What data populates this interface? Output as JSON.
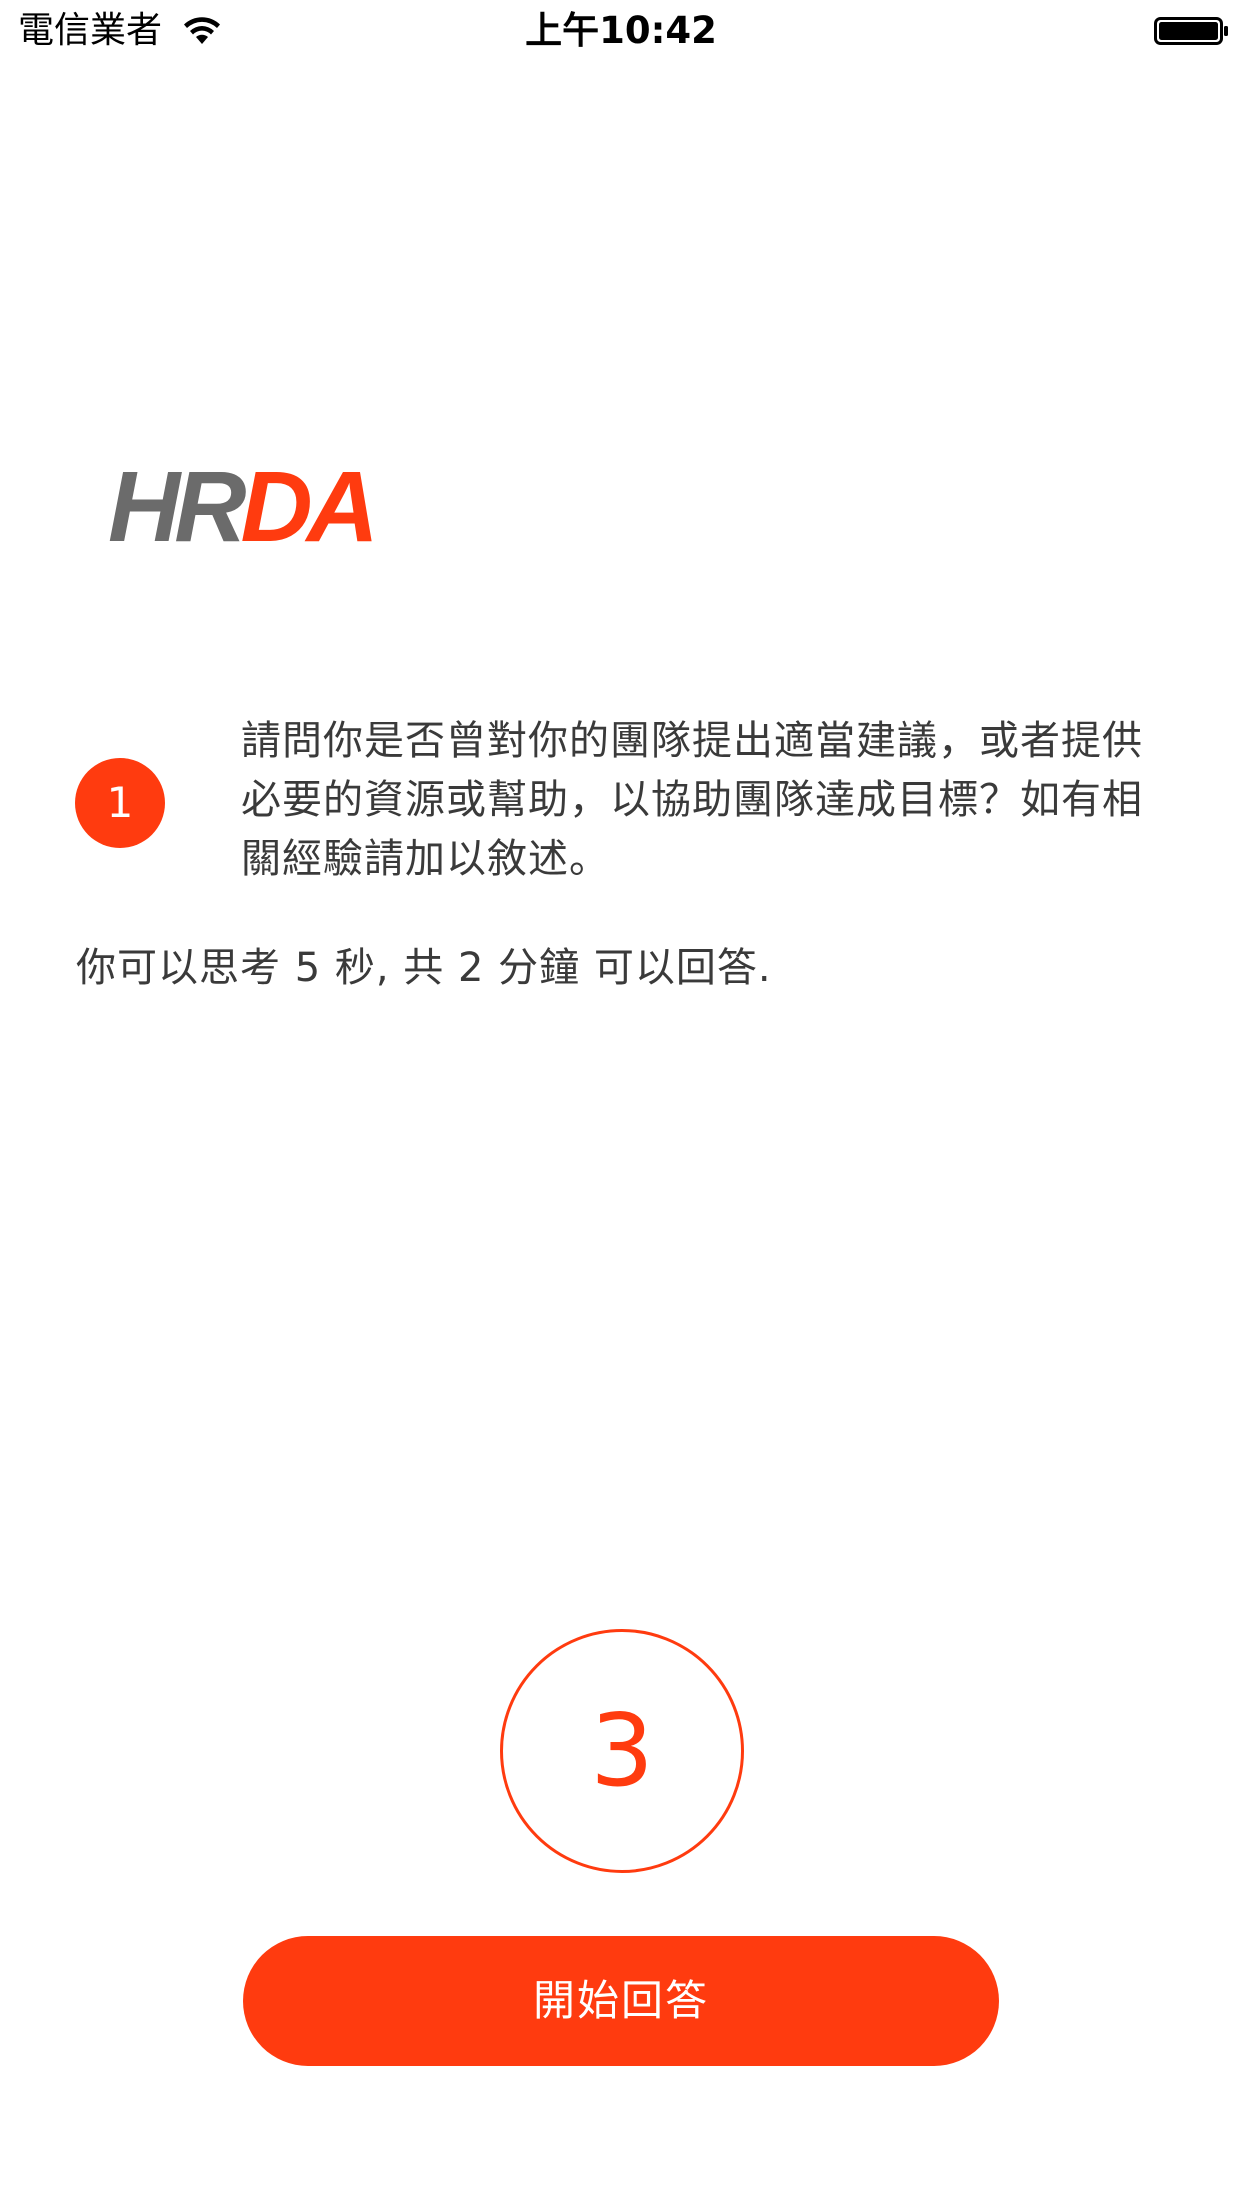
{
  "status_bar": {
    "carrier": "電信業者",
    "time": "上午10:42"
  },
  "logo": {
    "part1": "HR",
    "part2": "DA"
  },
  "question": {
    "number": "1",
    "text": "請問你是否曾對你的團隊提出適當建議，或者提供必要的資源或幫助，以協助團隊達成目標？如有相關經驗請加以敘述。"
  },
  "hint": "你可以思考 5 秒, 共 2 分鐘 可以回答.",
  "countdown": "3",
  "start_button_label": "開始回答",
  "colors": {
    "accent": "#ff3b0f",
    "logo_gray": "#6b6b6b",
    "text": "#3a3a3a"
  }
}
